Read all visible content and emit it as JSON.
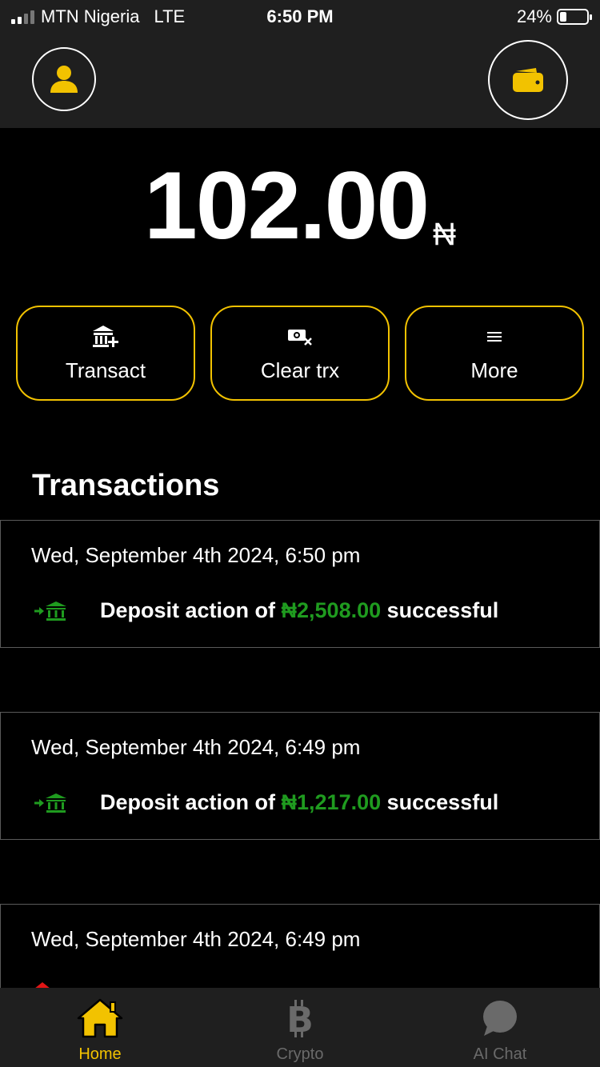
{
  "status_bar": {
    "carrier": "MTN Nigeria",
    "network": "LTE",
    "time": "6:50 PM",
    "battery": "24%"
  },
  "header": {
    "profile_icon": "user-icon",
    "wallet_icon": "wallet-icon"
  },
  "balance": {
    "amount": "102.00",
    "currency": "₦"
  },
  "actions": [
    {
      "label": "Transact",
      "icon": "bank-plus-icon"
    },
    {
      "label": "Clear trx",
      "icon": "money-clear-icon"
    },
    {
      "label": "More",
      "icon": "menu-icon"
    }
  ],
  "transactions": {
    "title": "Transactions",
    "items": [
      {
        "date": "Wed, September 4th 2024, 6:50 pm",
        "prefix": "Deposit action of ",
        "amount": "₦2,508.00",
        "suffix": " successful",
        "kind": "deposit"
      },
      {
        "date": "Wed, September 4th 2024, 6:49 pm",
        "prefix": "Deposit action of ",
        "amount": "₦1,217.00",
        "suffix": " successful",
        "kind": "deposit"
      },
      {
        "date": "Wed, September 4th 2024, 6:49 pm",
        "prefix": "",
        "amount": "",
        "suffix": "",
        "kind": "withdrawal"
      }
    ]
  },
  "nav": [
    {
      "label": "Home",
      "icon": "home-icon"
    },
    {
      "label": "Crypto",
      "icon": "bitcoin-icon"
    },
    {
      "label": "AI Chat",
      "icon": "chat-icon"
    }
  ],
  "colors": {
    "accent": "#f2c200",
    "success": "#1f9b1f",
    "danger": "#e01515",
    "background": "#000000",
    "surface": "#1f1f1f"
  }
}
